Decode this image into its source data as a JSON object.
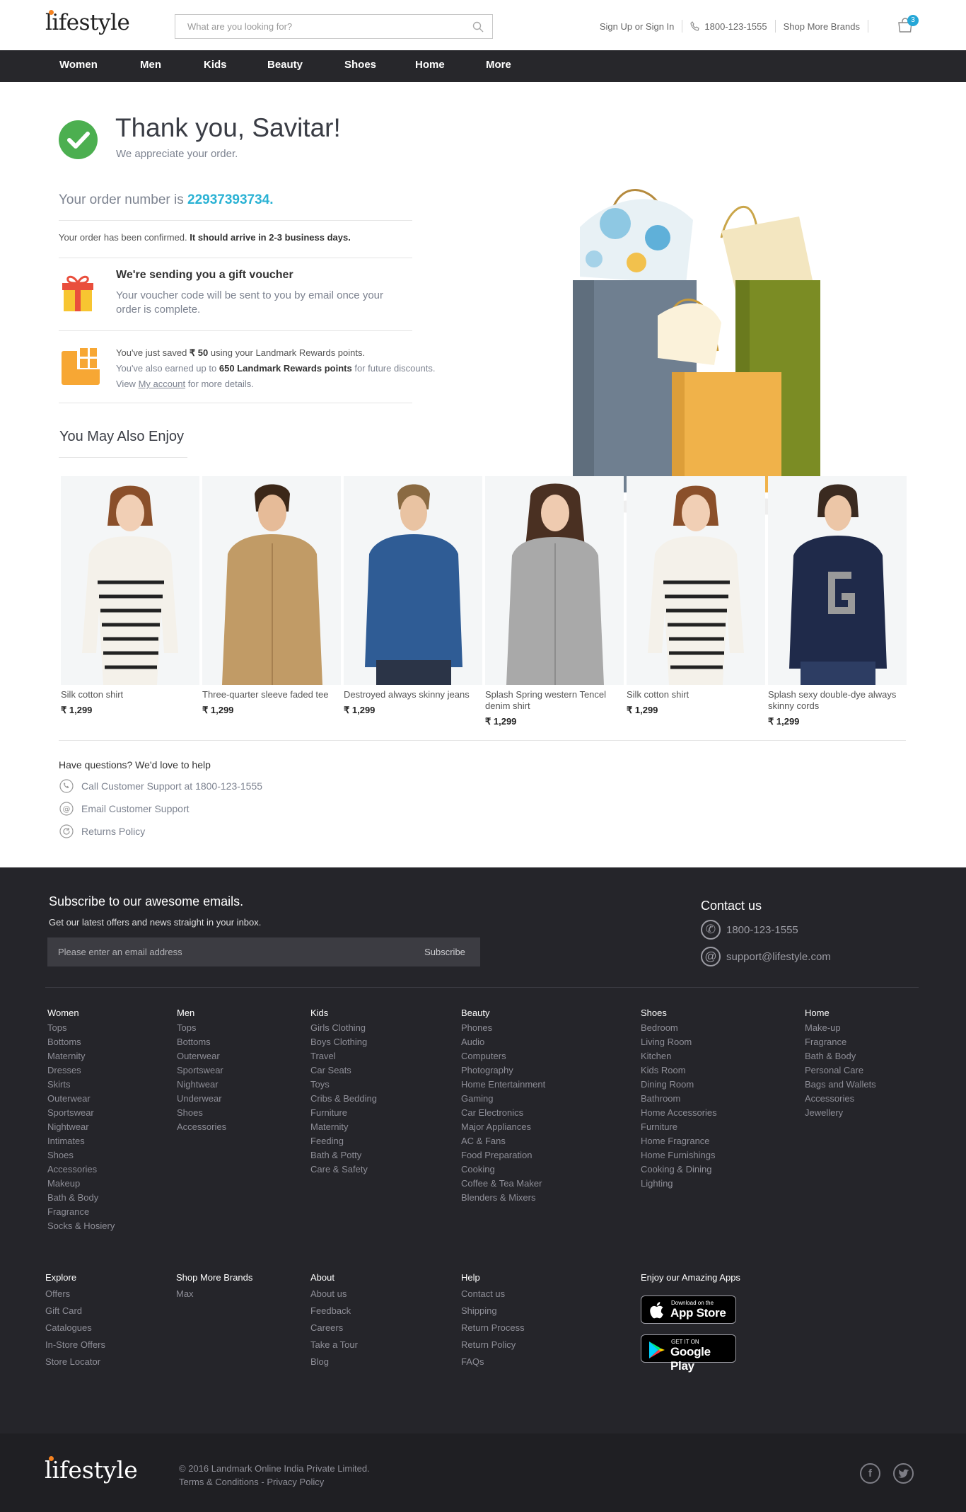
{
  "header": {
    "logo": "lifestyle",
    "search_placeholder": "What are you looking for?",
    "signin": "Sign Up or Sign In",
    "phone": "1800-123-1555",
    "shop_more": "Shop More Brands",
    "cart_count": "3"
  },
  "nav": [
    "Women",
    "Men",
    "Kids",
    "Beauty",
    "Shoes",
    "Home",
    "More"
  ],
  "confirmation": {
    "title": "Thank you, Savitar!",
    "subtitle": "We appreciate your order.",
    "order_prefix": "Your order number is",
    "order_number": "22937393734.",
    "confirmed_text": "Your order has been confirmed.",
    "arrival_text": "It should arrive in 2-3 business days.",
    "voucher_title": "We're sending you a gift voucher",
    "voucher_text": "Your voucher code will be sent to you by email once your order is complete.",
    "rewards_line1_pre": "You've just saved",
    "rewards_line1_bold": "₹ 50",
    "rewards_line1_post": "using your Landmark Rewards points.",
    "rewards_line2_pre": "You've also earned up to",
    "rewards_line2_bold": "650 Landmark Rewards points",
    "rewards_line2_post": "for future discounts.",
    "rewards_line3_pre": "View",
    "rewards_line3_link": "My account",
    "rewards_line3_post": "for more details."
  },
  "recommend": {
    "title": "You May Also Enjoy",
    "products": [
      {
        "name": "Silk cotton shirt",
        "price": "₹ 1,299"
      },
      {
        "name": "Three-quarter sleeve faded tee",
        "price": "₹ 1,299"
      },
      {
        "name": "Destroyed always skinny jeans",
        "price": "₹ 1,299"
      },
      {
        "name": "Splash Spring western Tencel denim shirt",
        "price": "₹ 1,299"
      },
      {
        "name": "Silk cotton shirt",
        "price": "₹ 1,299"
      },
      {
        "name": "Splash sexy double-dye always skinny cords",
        "price": "₹ 1,299"
      }
    ]
  },
  "help": {
    "title": "Have questions? We'd love to help",
    "call": "Call Customer Support at 1800-123-1555",
    "email": "Email Customer Support",
    "returns": "Returns Policy"
  },
  "footer": {
    "subscribe_title": "Subscribe to our awesome emails.",
    "subscribe_sub": "Get our latest offers and news straight in your inbox.",
    "email_placeholder": "Please enter an email address",
    "subscribe_btn": "Subscribe",
    "contact_title": "Contact us",
    "contact_phone": "1800-123-1555",
    "contact_email": "support@lifestyle.com",
    "columns": [
      {
        "title": "Women",
        "items": [
          "Tops",
          "Bottoms",
          "Maternity",
          "Dresses",
          "Skirts",
          "Outerwear",
          "Sportswear",
          "Nightwear",
          "Intimates",
          "Shoes",
          "Accessories",
          "Makeup",
          "Bath & Body",
          "Fragrance",
          "Socks & Hosiery"
        ]
      },
      {
        "title": "Men",
        "items": [
          "Tops",
          "Bottoms",
          "Outerwear",
          "Sportswear",
          "Nightwear",
          "Underwear",
          "Shoes",
          "Accessories"
        ]
      },
      {
        "title": "Kids",
        "items": [
          "Girls Clothing",
          "Boys Clothing",
          "Travel",
          "Car Seats",
          "Toys",
          "Cribs & Bedding",
          "Furniture",
          "Maternity",
          "Feeding",
          "Bath & Potty",
          "Care & Safety"
        ]
      },
      {
        "title": "Beauty",
        "items": [
          "Phones",
          "Audio",
          "Computers",
          "Photography",
          "Home Entertainment",
          "Gaming",
          "Car Electronics",
          "Major Appliances",
          "AC & Fans",
          "Food Preparation",
          "Cooking",
          "Coffee & Tea Maker",
          "Blenders & Mixers"
        ]
      },
      {
        "title": "Shoes",
        "items": [
          "Bedroom",
          "Living Room",
          "Kitchen",
          "Kids Room",
          "Dining Room",
          "Bathroom",
          "Home Accessories",
          "Furniture",
          "Home Fragrance",
          "Home Furnishings",
          "Cooking & Dining",
          "Lighting"
        ]
      },
      {
        "title": "Home",
        "items": [
          "Make-up",
          "Fragrance",
          "Bath & Body",
          "Personal Care",
          "Bags and Wallets",
          "Accessories",
          "Jewellery"
        ]
      }
    ],
    "columns2": [
      {
        "title": "Explore",
        "items": [
          "Offers",
          "Gift Card",
          "Catalogues",
          "In-Store Offers",
          "Store Locator"
        ]
      },
      {
        "title": "Shop More Brands",
        "items": [
          "Max"
        ]
      },
      {
        "title": "About",
        "items": [
          "About us",
          "Feedback",
          "Careers",
          "Take a Tour",
          "Blog"
        ]
      },
      {
        "title": "Help",
        "items": [
          "Contact us",
          "Shipping",
          "Return Process",
          "Return Policy",
          "FAQs"
        ]
      }
    ],
    "apps_title": "Enjoy our Amazing Apps",
    "appstore_small": "Download on the",
    "appstore_big": "App Store",
    "gplay_small": "GET IT ON",
    "gplay_big": "Google Play"
  },
  "bottom": {
    "logo": "lifestyle",
    "copyright": "© 2016 Landmark Online India Private Limited.",
    "terms": "Terms & Conditions",
    "dash": "-",
    "privacy": "Privacy Policy"
  }
}
